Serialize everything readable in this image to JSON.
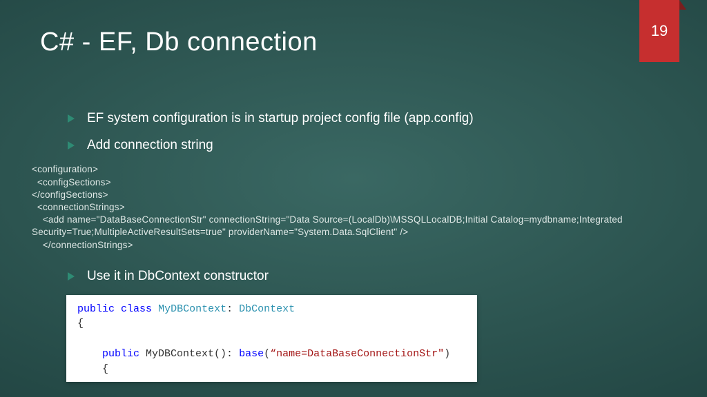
{
  "page_number": "19",
  "title": "C# - EF, Db connection",
  "bullets": {
    "b1": "EF system configuration is in startup project config file (app.config)",
    "b2": "Add connection string",
    "b3": "Use it in DbContext constructor"
  },
  "config_xml": "<configuration>\n  <configSections>\n</configSections>\n  <connectionStrings>\n    <add name=\"DataBaseConnectionStr\" connectionString=\"Data Source=(LocalDb)\\MSSQLLocalDB;Initial Catalog=mydbname;Integrated Security=True;MultipleActiveResultSets=true\" providerName=\"System.Data.SqlClient\" />\n    </connectionStrings>",
  "code": {
    "kw_public1": "public",
    "kw_class": "class",
    "type_name": "MyDBContext",
    "colon1": ": ",
    "base_type": "DbContext",
    "brace_open": "{",
    "kw_public2": "public",
    "ctor_name": " MyDBContext(): ",
    "kw_base": "base",
    "paren_open": "(",
    "str_arg": "“name=DataBaseConnectionStr\"",
    "paren_close": ")",
    "brace_open2": "{"
  }
}
